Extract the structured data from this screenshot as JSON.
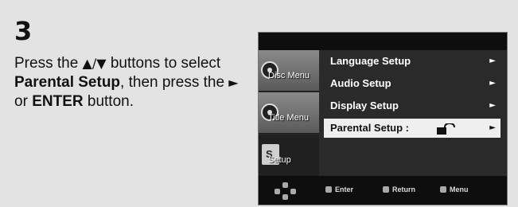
{
  "step": "3",
  "instructions": {
    "part1": "Press the ",
    "updown": "▲/▼",
    "part2": " buttons to select ",
    "bold1": "Parental Setup",
    "part3": ", then press the ",
    "right": "►",
    "part4": " or ",
    "bold2": "ENTER",
    "part5": " button."
  },
  "side_menu": [
    {
      "label": "Disc Menu"
    },
    {
      "label": "Title Menu"
    },
    {
      "label": "Setup"
    }
  ],
  "menu_items": [
    {
      "label": "Language Setup",
      "arrow": "►"
    },
    {
      "label": "Audio Setup",
      "arrow": "►"
    },
    {
      "label": "Display Setup",
      "arrow": "►"
    },
    {
      "label": "Parental Setup :",
      "arrow": "►",
      "selected": true
    }
  ],
  "bottom_bar": {
    "enter": "Enter",
    "return": "Return",
    "menu": "Menu"
  },
  "colors": {
    "page_bg": "#e3e3e3",
    "osd_bg": "#2a2a2a",
    "selected_bg": "#efefef"
  }
}
